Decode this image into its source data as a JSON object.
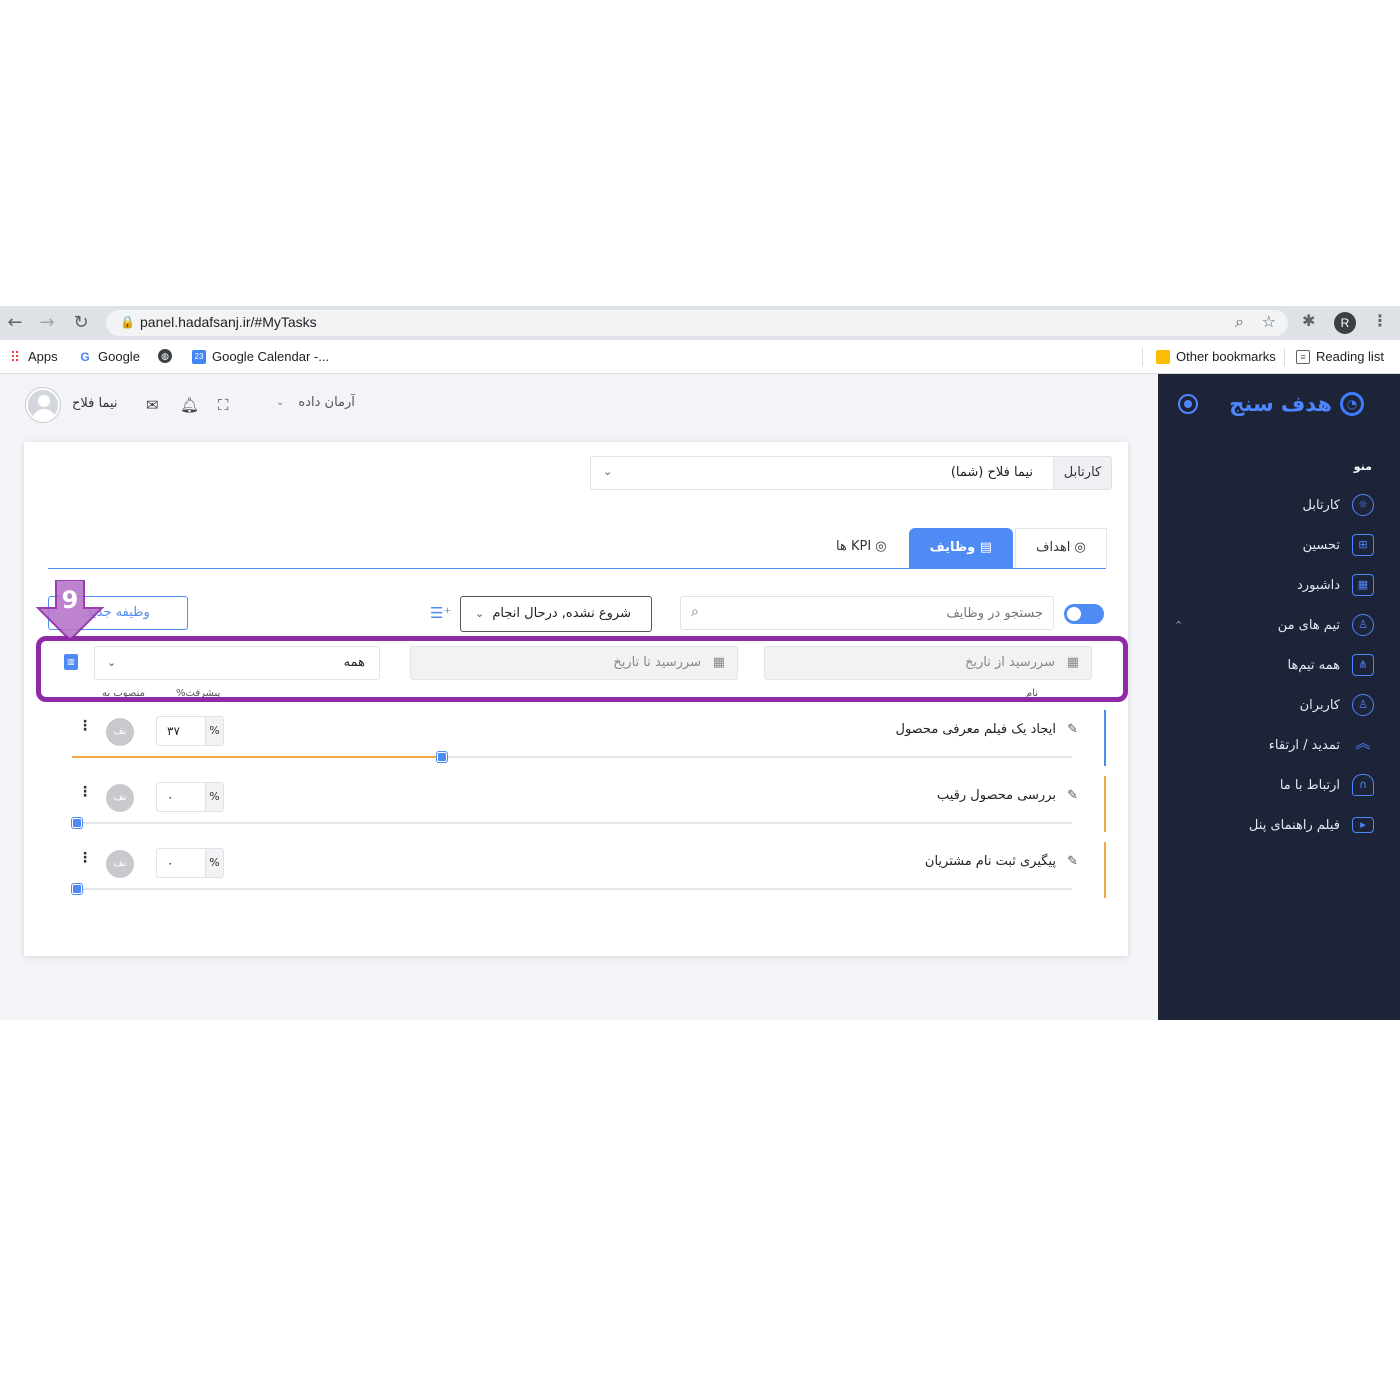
{
  "browser": {
    "url": "panel.hadafsanj.ir/#MyTasks",
    "profile_initial": "R",
    "bookmarks": [
      {
        "label": "Apps",
        "icon": "apps-grid-icon"
      },
      {
        "label": "Google",
        "icon": "google-icon"
      },
      {
        "label": "",
        "icon": "globe-icon"
      },
      {
        "label": "Google Calendar -...",
        "icon": "calendar-icon"
      }
    ],
    "other_bookmarks": "Other bookmarks",
    "reading_list": "Reading list"
  },
  "sidebar": {
    "brand": "هدف سنج",
    "menu_title": "منو",
    "items": [
      {
        "label": "کارتابل",
        "icon": "lightbulb-icon"
      },
      {
        "label": "تحسین",
        "icon": "gift-icon"
      },
      {
        "label": "داشبورد",
        "icon": "dashboard-grid-icon"
      },
      {
        "label": "تیم های من",
        "icon": "user-icon"
      },
      {
        "label": "همه تیم‌ها",
        "icon": "org-chart-icon"
      },
      {
        "label": "کاربران",
        "icon": "users-icon"
      },
      {
        "label": "تمدید / ارتقاء",
        "icon": "chevrons-up-icon"
      },
      {
        "label": "ارتباط با ما",
        "icon": "headphones-icon"
      },
      {
        "label": "فیلم راهنمای پنل",
        "icon": "video-icon"
      }
    ]
  },
  "header": {
    "user_name": "نیما فلاح",
    "company": "آرمان داده"
  },
  "kartabl": {
    "label": "کارتابل",
    "value": "نیما فلاح (شما)"
  },
  "tabs": [
    {
      "label": "اهداف",
      "active": false
    },
    {
      "label": "وظایف",
      "active": true
    },
    {
      "label": "KPI ها",
      "active": false
    }
  ],
  "toolbar": {
    "search_placeholder": "جستجو در وظایف",
    "status_value": "شروع نشده, درحال انجام",
    "new_task_label": "وظیفه جدید"
  },
  "filters": {
    "due_from_placeholder": "سررسید از تاریخ",
    "due_to_placeholder": "سررسید تا تاریخ",
    "assignee_value": "همه"
  },
  "columns": {
    "name": "نام",
    "progress": "پیشرفت%",
    "assigned_to": "منصوب به"
  },
  "tasks": [
    {
      "name": "ایجاد یک فیلم معرفی محصول",
      "progress_display": "۳۷",
      "progress": 0.37,
      "accent": "#4f8bf5",
      "assignee_initials": "نف"
    },
    {
      "name": "بررسی محصول رقیب",
      "progress_display": "۰",
      "progress": 0,
      "accent": "#f7a941",
      "assignee_initials": "نف"
    },
    {
      "name": "پیگیری ثبت نام مشتریان",
      "progress_display": "۰",
      "progress": 0,
      "accent": "#f7a941",
      "assignee_initials": "نف"
    }
  ],
  "annotation": {
    "step_number": "9",
    "color": "#8e2aa5"
  }
}
